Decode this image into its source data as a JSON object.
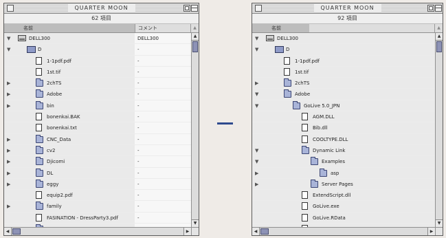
{
  "left_window": {
    "title": "QUARTER MOON",
    "item_count": "62 項目",
    "header_name": "名前",
    "header_comment": "コメント",
    "rows": [
      {
        "indent": 0,
        "disclosure": "▼",
        "icon": "drive-icon",
        "name": "DELL300",
        "comment": "DELL300"
      },
      {
        "indent": 1,
        "disclosure": "▼",
        "icon": "netdrive-icon",
        "name": "D",
        "comment": "-"
      },
      {
        "indent": 2,
        "disclosure": "",
        "icon": "file-icon",
        "name": "1-1pdf.pdf",
        "comment": "-"
      },
      {
        "indent": 2,
        "disclosure": "",
        "icon": "file-icon",
        "name": "1st.tif",
        "comment": "-"
      },
      {
        "indent": 2,
        "disclosure": "▶",
        "icon": "folder-icon",
        "name": "2chTS",
        "comment": "-"
      },
      {
        "indent": 2,
        "disclosure": "▶",
        "icon": "folder-icon",
        "name": "Adobe",
        "comment": "-"
      },
      {
        "indent": 2,
        "disclosure": "▶",
        "icon": "folder-icon",
        "name": "bin",
        "comment": "-"
      },
      {
        "indent": 2,
        "disclosure": "",
        "icon": "file-icon",
        "name": "bonenkai.BAK",
        "comment": "-"
      },
      {
        "indent": 2,
        "disclosure": "",
        "icon": "file-icon",
        "name": "bonenkai.txt",
        "comment": "-"
      },
      {
        "indent": 2,
        "disclosure": "▶",
        "icon": "folder-icon",
        "name": "CNC_Data",
        "comment": "-"
      },
      {
        "indent": 2,
        "disclosure": "▶",
        "icon": "folder-icon",
        "name": "cv2",
        "comment": "-"
      },
      {
        "indent": 2,
        "disclosure": "▶",
        "icon": "folder-icon",
        "name": "Djicomi",
        "comment": "-"
      },
      {
        "indent": 2,
        "disclosure": "▶",
        "icon": "folder-icon",
        "name": "DL",
        "comment": "-"
      },
      {
        "indent": 2,
        "disclosure": "▶",
        "icon": "folder-icon",
        "name": "eggy",
        "comment": "-"
      },
      {
        "indent": 2,
        "disclosure": "",
        "icon": "file-icon",
        "name": "equip2.pdf",
        "comment": "-"
      },
      {
        "indent": 2,
        "disclosure": "▶",
        "icon": "folder-icon",
        "name": "family",
        "comment": "-"
      },
      {
        "indent": 2,
        "disclosure": "",
        "icon": "file-icon",
        "name": "FASINATION - DressParty3.pdf",
        "comment": "-"
      },
      {
        "indent": 2,
        "disclosure": "▶",
        "icon": "folder-icon",
        "name": "",
        "comment": ""
      }
    ]
  },
  "right_window": {
    "title": "QUARTER MOON",
    "item_count": "92 項目",
    "header_name": "名前",
    "header_comment": "",
    "rows": [
      {
        "indent": 0,
        "disclosure": "▼",
        "icon": "drive-icon",
        "name": "DELL300",
        "comment": ""
      },
      {
        "indent": 1,
        "disclosure": "▼",
        "icon": "netdrive-icon",
        "name": "D",
        "comment": ""
      },
      {
        "indent": 2,
        "disclosure": "",
        "icon": "file-icon",
        "name": "1-1pdf.pdf",
        "comment": ""
      },
      {
        "indent": 2,
        "disclosure": "",
        "icon": "file-icon",
        "name": "1st.tif",
        "comment": ""
      },
      {
        "indent": 2,
        "disclosure": "▶",
        "icon": "folder-icon",
        "name": "2chTS",
        "comment": ""
      },
      {
        "indent": 2,
        "disclosure": "▼",
        "icon": "folder-icon",
        "name": "Adobe",
        "comment": ""
      },
      {
        "indent": 3,
        "disclosure": "▼",
        "icon": "folder-icon",
        "name": "GoLive 5.0_JPN",
        "comment": ""
      },
      {
        "indent": 4,
        "disclosure": "",
        "icon": "file-icon",
        "name": "AGM.DLL",
        "comment": ""
      },
      {
        "indent": 4,
        "disclosure": "",
        "icon": "file-icon",
        "name": "Bib.dll",
        "comment": ""
      },
      {
        "indent": 4,
        "disclosure": "",
        "icon": "file-icon",
        "name": "COOLTYPE.DLL",
        "comment": ""
      },
      {
        "indent": 4,
        "disclosure": "▼",
        "icon": "folder-icon",
        "name": "Dynamic Link",
        "comment": ""
      },
      {
        "indent": 5,
        "disclosure": "▼",
        "icon": "folder-icon",
        "name": "Examples",
        "comment": ""
      },
      {
        "indent": 6,
        "disclosure": "▶",
        "icon": "folder-icon",
        "name": "asp",
        "comment": ""
      },
      {
        "indent": 5,
        "disclosure": "▶",
        "icon": "folder-icon",
        "name": "Server Pages",
        "comment": ""
      },
      {
        "indent": 4,
        "disclosure": "",
        "icon": "file-icon",
        "name": "ExtendScript.dll",
        "comment": ""
      },
      {
        "indent": 4,
        "disclosure": "",
        "icon": "file-icon",
        "name": "GoLive.exe",
        "comment": ""
      },
      {
        "indent": 4,
        "disclosure": "",
        "icon": "file-icon",
        "name": "GoLive.RData",
        "comment": ""
      },
      {
        "indent": 4,
        "disclosure": "",
        "icon": "file-icon",
        "name": "",
        "comment": ""
      }
    ]
  },
  "colors": {
    "connector": "#2e4a8e",
    "folder": "#a9b4d8",
    "scroll_thumb": "#8e93b6"
  }
}
